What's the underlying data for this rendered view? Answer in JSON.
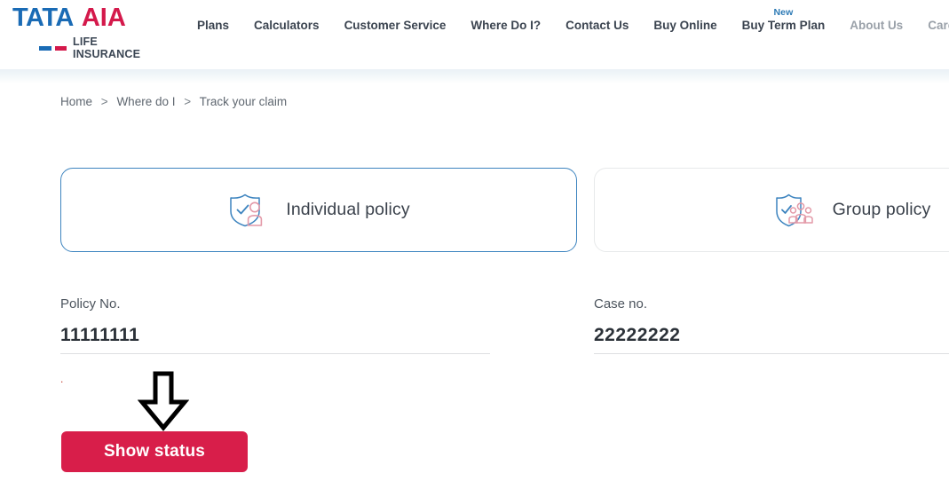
{
  "brand": {
    "name_primary": "TATA",
    "name_secondary": "AIA",
    "tagline": "LIFE INSURANCE",
    "color_primary": "#1a6bb5",
    "color_secondary": "#d4194b"
  },
  "nav": {
    "items": [
      {
        "label": "Plans",
        "muted": false,
        "badge": ""
      },
      {
        "label": "Calculators",
        "muted": false,
        "badge": ""
      },
      {
        "label": "Customer Service",
        "muted": false,
        "badge": ""
      },
      {
        "label": "Where Do I?",
        "muted": false,
        "badge": ""
      },
      {
        "label": "Contact Us",
        "muted": false,
        "badge": ""
      },
      {
        "label": "Buy Online",
        "muted": false,
        "badge": ""
      },
      {
        "label": "Buy Term Plan",
        "muted": false,
        "badge": "New"
      },
      {
        "label": "About Us",
        "muted": true,
        "badge": ""
      },
      {
        "label": "Careers",
        "muted": true,
        "badge": ""
      }
    ],
    "badge_color": "#2d7ab5"
  },
  "breadcrumb": {
    "items": [
      "Home",
      "Where do I",
      "Track your claim"
    ],
    "separator": ">"
  },
  "policy_type": {
    "individual": {
      "label": "Individual policy",
      "icon": "shield-person-icon",
      "selected": true,
      "border_color": "#3d84bf"
    },
    "group": {
      "label": "Group policy",
      "icon": "shield-group-icon",
      "selected": false,
      "border_color": "#e7e9ea"
    }
  },
  "form": {
    "policy_no": {
      "label": "Policy No.",
      "value": "11111111",
      "placeholder": "Policy No."
    },
    "case_no": {
      "label": "Case no.",
      "value": "22222222",
      "placeholder": "Case no."
    },
    "error_text": ".",
    "submit_label": "Show status",
    "submit_color": "#d81e4a"
  },
  "annotation": {
    "arrow": "down-arrow-annotation"
  }
}
